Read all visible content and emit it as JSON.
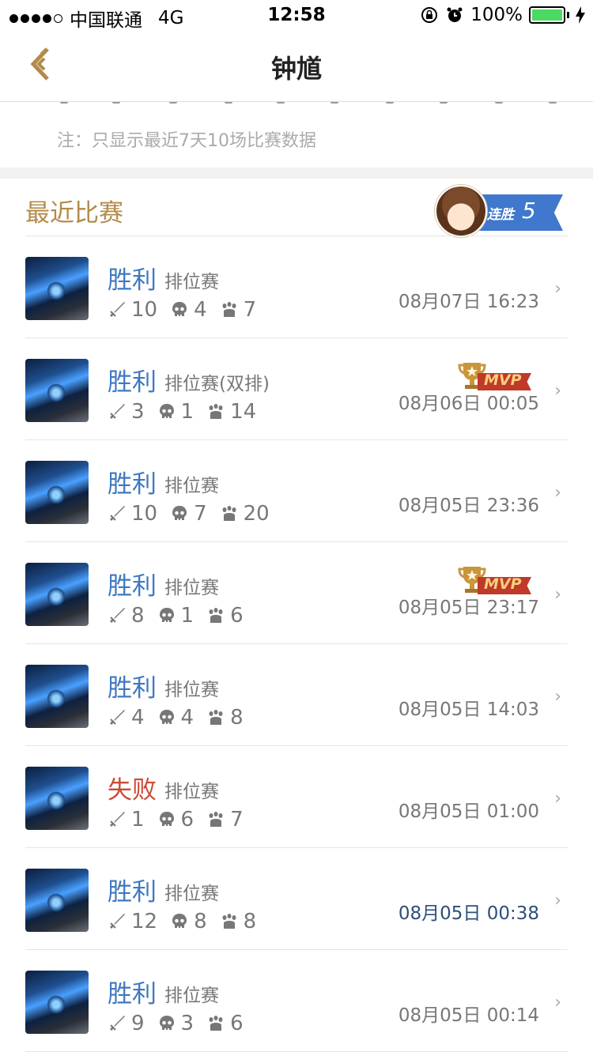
{
  "status_bar": {
    "carrier": "中国联通",
    "network": "4G",
    "time": "12:58",
    "battery": "100%"
  },
  "nav": {
    "title": "钟馗",
    "back_icon": "back-chevron-icon"
  },
  "note": "注：只显示最近7天10场比赛数据",
  "section": {
    "title": "最近比赛",
    "streak_label": "连胜",
    "streak_count": "5"
  },
  "colors": {
    "accent": "#b38a4a",
    "win": "#3f78c0",
    "lose": "#c94b34",
    "streak": "#3f78cc"
  },
  "matches": [
    {
      "result": "胜利",
      "mode": "排位赛",
      "kills": "10",
      "deaths": "4",
      "assists": "7",
      "time": "08月07日 16:23",
      "mvp": false
    },
    {
      "result": "胜利",
      "mode": "排位赛(双排)",
      "kills": "3",
      "deaths": "1",
      "assists": "14",
      "time": "08月06日 00:05",
      "mvp": true,
      "mvp_label": "MVP"
    },
    {
      "result": "胜利",
      "mode": "排位赛",
      "kills": "10",
      "deaths": "7",
      "assists": "20",
      "time": "08月05日 23:36",
      "mvp": false
    },
    {
      "result": "胜利",
      "mode": "排位赛",
      "kills": "8",
      "deaths": "1",
      "assists": "6",
      "time": "08月05日 23:17",
      "mvp": true,
      "mvp_label": "MVP"
    },
    {
      "result": "胜利",
      "mode": "排位赛",
      "kills": "4",
      "deaths": "4",
      "assists": "8",
      "time": "08月05日 14:03",
      "mvp": false
    },
    {
      "result": "失败",
      "mode": "排位赛",
      "kills": "1",
      "deaths": "6",
      "assists": "7",
      "time": "08月05日 01:00",
      "mvp": false
    },
    {
      "result": "胜利",
      "mode": "排位赛",
      "kills": "12",
      "deaths": "8",
      "assists": "8",
      "time": "08月05日 00:38",
      "mvp": false
    },
    {
      "result": "胜利",
      "mode": "排位赛",
      "kills": "9",
      "deaths": "3",
      "assists": "6",
      "time": "08月05日 00:14",
      "mvp": false
    }
  ]
}
